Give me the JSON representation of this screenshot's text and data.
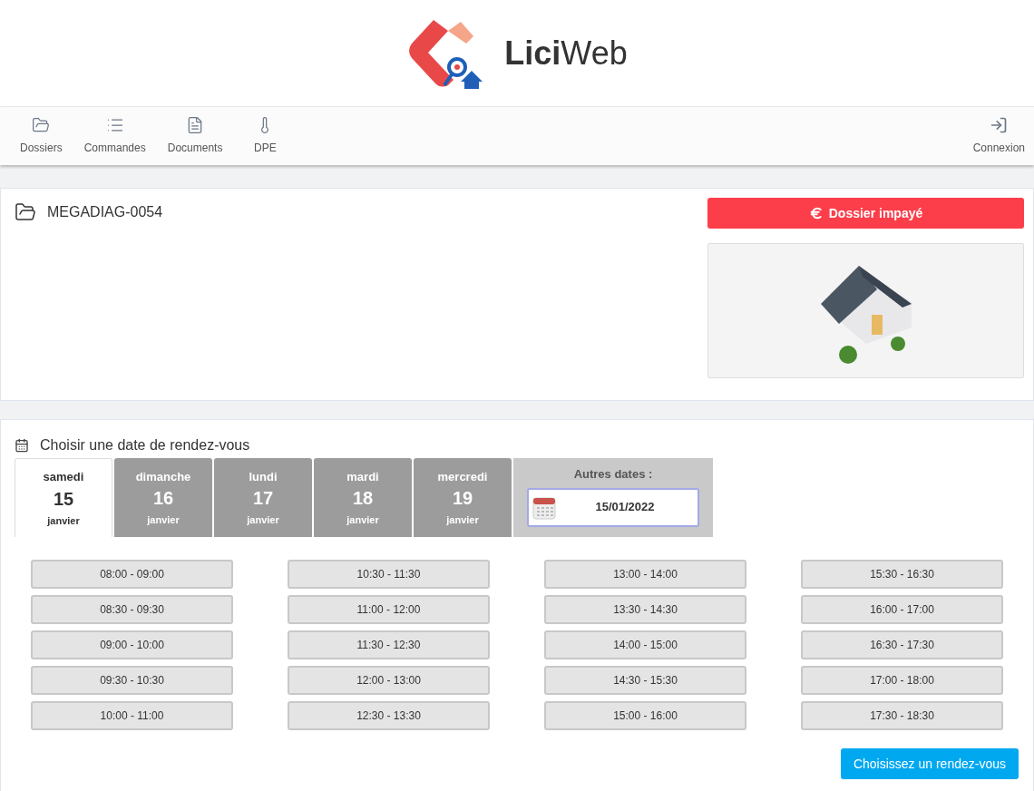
{
  "brand": {
    "bold": "Lici",
    "light": "Web"
  },
  "nav": [
    {
      "label": "Dossiers",
      "kind": "folder"
    },
    {
      "label": "Commandes",
      "kind": "list"
    },
    {
      "label": "Documents",
      "kind": "doc"
    },
    {
      "label": "DPE",
      "kind": "thermo"
    }
  ],
  "login": {
    "label": "Connexion"
  },
  "dossier": {
    "reference": "MEGADIAG-0054",
    "status_button": "Dossier impayé"
  },
  "booking": {
    "title": "Choisir une date de rendez-vous",
    "days": [
      {
        "weekday": "samedi",
        "day": "15",
        "month": "janvier",
        "selected": true
      },
      {
        "weekday": "dimanche",
        "day": "16",
        "month": "janvier",
        "selected": false
      },
      {
        "weekday": "lundi",
        "day": "17",
        "month": "janvier",
        "selected": false
      },
      {
        "weekday": "mardi",
        "day": "18",
        "month": "janvier",
        "selected": false
      },
      {
        "weekday": "mercredi",
        "day": "19",
        "month": "janvier",
        "selected": false
      }
    ],
    "other_dates": {
      "label": "Autres dates :",
      "value": "15/01/2022"
    },
    "slot_columns": [
      [
        "08:00 - 09:00",
        "08:30 - 09:30",
        "09:00 - 10:00",
        "09:30 - 10:30",
        "10:00 - 11:00"
      ],
      [
        "10:30 - 11:30",
        "11:00 - 12:00",
        "11:30 - 12:30",
        "12:00 - 13:00",
        "12:30 - 13:30"
      ],
      [
        "13:00 - 14:00",
        "13:30 - 14:30",
        "14:00 - 15:00",
        "14:30 - 15:30",
        "15:00 - 16:00"
      ],
      [
        "15:30 - 16:30",
        "16:00 - 17:00",
        "16:30 - 17:30",
        "17:00 - 18:00",
        "17:30 - 18:30"
      ]
    ],
    "submit": "Choisissez un rendez-vous"
  }
}
